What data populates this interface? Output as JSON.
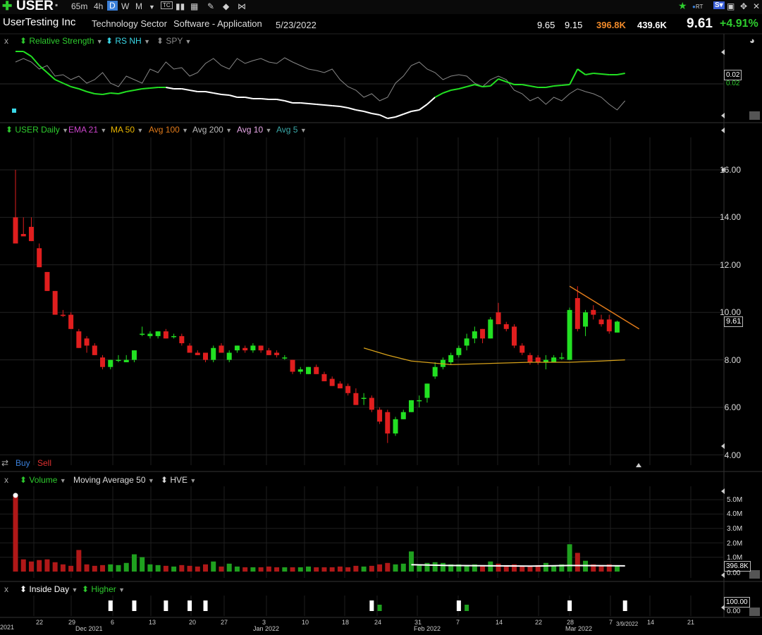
{
  "toolbar": {
    "symbol": "USER",
    "timeframes": [
      "65m",
      "4h",
      "D",
      "W",
      "M"
    ],
    "active_timeframe": "D",
    "rt_label": "RT"
  },
  "info": {
    "company": "UserTesting Inc",
    "sector": "Technology Sector",
    "industry": "Software - Application",
    "date": "5/23/2022",
    "high": "9.65",
    "low": "9.15",
    "volume": "396.8K",
    "avg_volume": "439.6K",
    "price": "9.61",
    "change": "+4.91%"
  },
  "rs_panel": {
    "close": "x",
    "items": [
      "Relative Strength",
      "RS NH",
      "SPY"
    ],
    "value_box": "0.02",
    "value_text": "0.02"
  },
  "price_panel": {
    "items": [
      "USER Daily",
      "EMA 21",
      "MA 50",
      "Avg 100",
      "Avg 200",
      "Avg 10",
      "Avg 5"
    ],
    "colors": [
      "#2ecc2e",
      "#cc44cc",
      "#e8b400",
      "#e07a1a",
      "#bbbbbb",
      "#e8a8e8",
      "#3aa8a8"
    ],
    "y_ticks": [
      "16.00",
      "14.00",
      "12.00",
      "10.00",
      "8.00",
      "6.00",
      "4.00"
    ],
    "price_box": "9.61",
    "buy_label": "Buy",
    "sell_label": "Sell"
  },
  "volume_panel": {
    "close": "x",
    "items": [
      "Volume",
      "Moving Average 50",
      "HVE"
    ],
    "y_ticks": [
      "5.0M",
      "4.0M",
      "3.0M",
      "2.0M",
      "1.0M",
      "0.00"
    ],
    "value_box": "396.8K"
  },
  "inside_panel": {
    "close": "x",
    "items": [
      "Inside Day",
      "Higher"
    ],
    "box_top": "100.00",
    "box_bottom": "0.00"
  },
  "dates": [
    "2021",
    "22",
    "29",
    "Dec 2021",
    "6",
    "13",
    "20",
    "27",
    "3",
    "Jan 2022",
    "10",
    "18",
    "24",
    "31",
    "Feb 2022",
    "7",
    "14",
    "22",
    "28",
    "Mar 2022",
    "7",
    "3/9/2022",
    "14",
    "21"
  ],
  "chart_data": {
    "type": "candlestick",
    "title": "USER Daily",
    "ylim": [
      3.5,
      17.5
    ],
    "candles": [
      {
        "o": 14.0,
        "h": 16.0,
        "l": 13.3,
        "c": 12.9,
        "v": 5.3
      },
      {
        "o": 13.3,
        "h": 14.0,
        "l": 13.3,
        "c": 13.2,
        "v": 0.85
      },
      {
        "o": 13.6,
        "h": 14.0,
        "l": 13.0,
        "c": 13.0,
        "v": 0.7
      },
      {
        "o": 12.7,
        "h": 12.9,
        "l": 11.9,
        "c": 11.9,
        "v": 0.8
      },
      {
        "o": 11.7,
        "h": 11.7,
        "l": 10.9,
        "c": 10.9,
        "v": 0.85
      },
      {
        "o": 10.9,
        "h": 10.9,
        "l": 9.9,
        "c": 9.9,
        "v": 0.65
      },
      {
        "o": 9.9,
        "h": 10.1,
        "l": 9.8,
        "c": 9.85,
        "v": 0.5
      },
      {
        "o": 9.9,
        "h": 10.0,
        "l": 9.3,
        "c": 9.3,
        "v": 0.4
      },
      {
        "o": 9.2,
        "h": 9.3,
        "l": 8.5,
        "c": 8.5,
        "v": 1.5
      },
      {
        "o": 8.9,
        "h": 9.0,
        "l": 8.3,
        "c": 8.6,
        "v": 0.5
      },
      {
        "o": 8.6,
        "h": 8.7,
        "l": 8.2,
        "c": 8.2,
        "v": 0.4
      },
      {
        "o": 8.1,
        "h": 8.2,
        "l": 7.6,
        "c": 7.7,
        "v": 0.45
      },
      {
        "o": 7.7,
        "h": 8.0,
        "l": 7.6,
        "c": 8.0,
        "v": 0.5
      },
      {
        "o": 8.0,
        "h": 8.2,
        "l": 7.9,
        "c": 8.0,
        "v": 0.45
      },
      {
        "o": 7.9,
        "h": 8.2,
        "l": 7.9,
        "c": 8.0,
        "v": 0.6
      },
      {
        "o": 8.0,
        "h": 8.4,
        "l": 7.9,
        "c": 8.4,
        "v": 1.2
      },
      {
        "o": 9.1,
        "h": 9.4,
        "l": 9.0,
        "c": 9.1,
        "v": 1.0
      },
      {
        "o": 9.0,
        "h": 9.2,
        "l": 8.9,
        "c": 9.1,
        "v": 0.5
      },
      {
        "o": 9.0,
        "h": 9.2,
        "l": 8.9,
        "c": 9.2,
        "v": 0.45
      },
      {
        "o": 9.2,
        "h": 9.3,
        "l": 8.9,
        "c": 8.9,
        "v": 0.4
      },
      {
        "o": 9.0,
        "h": 9.1,
        "l": 8.9,
        "c": 9.0,
        "v": 0.35
      },
      {
        "o": 9.0,
        "h": 9.1,
        "l": 8.6,
        "c": 8.7,
        "v": 0.45
      },
      {
        "o": 8.6,
        "h": 8.7,
        "l": 8.3,
        "c": 8.3,
        "v": 0.4
      },
      {
        "o": 8.3,
        "h": 8.4,
        "l": 8.2,
        "c": 8.2,
        "v": 0.35
      },
      {
        "o": 8.3,
        "h": 8.3,
        "l": 7.9,
        "c": 8.0,
        "v": 0.5
      },
      {
        "o": 8.0,
        "h": 8.6,
        "l": 7.9,
        "c": 8.5,
        "v": 0.7
      },
      {
        "o": 8.6,
        "h": 8.7,
        "l": 8.3,
        "c": 8.3,
        "v": 0.35
      },
      {
        "o": 8.0,
        "h": 8.4,
        "l": 7.9,
        "c": 8.3,
        "v": 0.55
      },
      {
        "o": 8.4,
        "h": 8.6,
        "l": 8.3,
        "c": 8.6,
        "v": 0.35
      },
      {
        "o": 8.5,
        "h": 8.6,
        "l": 8.3,
        "c": 8.4,
        "v": 0.3
      },
      {
        "o": 8.4,
        "h": 8.7,
        "l": 8.3,
        "c": 8.6,
        "v": 0.3
      },
      {
        "o": 8.6,
        "h": 8.6,
        "l": 8.3,
        "c": 8.4,
        "v": 0.3
      },
      {
        "o": 8.4,
        "h": 8.5,
        "l": 8.2,
        "c": 8.2,
        "v": 0.35
      },
      {
        "o": 8.3,
        "h": 8.4,
        "l": 8.1,
        "c": 8.2,
        "v": 0.3
      },
      {
        "o": 8.1,
        "h": 8.2,
        "l": 8.0,
        "c": 8.1,
        "v": 0.3
      },
      {
        "o": 8.0,
        "h": 8.0,
        "l": 7.4,
        "c": 7.5,
        "v": 0.3
      },
      {
        "o": 7.5,
        "h": 7.7,
        "l": 7.4,
        "c": 7.6,
        "v": 0.3
      },
      {
        "o": 7.4,
        "h": 7.7,
        "l": 7.4,
        "c": 7.7,
        "v": 0.35
      },
      {
        "o": 7.7,
        "h": 7.8,
        "l": 7.4,
        "c": 7.4,
        "v": 0.3
      },
      {
        "o": 7.4,
        "h": 7.5,
        "l": 7.1,
        "c": 7.1,
        "v": 0.3
      },
      {
        "o": 7.2,
        "h": 7.3,
        "l": 6.9,
        "c": 6.9,
        "v": 0.3
      },
      {
        "o": 7.0,
        "h": 7.1,
        "l": 6.8,
        "c": 6.8,
        "v": 0.35
      },
      {
        "o": 6.9,
        "h": 7.0,
        "l": 6.5,
        "c": 6.6,
        "v": 0.3
      },
      {
        "o": 6.6,
        "h": 6.8,
        "l": 6.1,
        "c": 6.1,
        "v": 0.4
      },
      {
        "o": 6.4,
        "h": 6.6,
        "l": 6.1,
        "c": 6.4,
        "v": 0.35
      },
      {
        "o": 6.4,
        "h": 6.5,
        "l": 5.8,
        "c": 5.9,
        "v": 0.4
      },
      {
        "o": 5.9,
        "h": 6.0,
        "l": 5.3,
        "c": 5.4,
        "v": 0.5
      },
      {
        "o": 5.8,
        "h": 5.9,
        "l": 4.5,
        "c": 4.9,
        "v": 0.6
      },
      {
        "o": 4.9,
        "h": 5.6,
        "l": 4.8,
        "c": 5.5,
        "v": 0.5
      },
      {
        "o": 5.5,
        "h": 5.9,
        "l": 5.5,
        "c": 5.8,
        "v": 0.55
      },
      {
        "o": 5.8,
        "h": 6.3,
        "l": 5.8,
        "c": 6.3,
        "v": 1.4
      },
      {
        "o": 6.3,
        "h": 6.5,
        "l": 6.0,
        "c": 6.3,
        "v": 0.5
      },
      {
        "o": 6.4,
        "h": 7.0,
        "l": 6.2,
        "c": 7.0,
        "v": 0.6
      },
      {
        "o": 7.3,
        "h": 7.9,
        "l": 7.2,
        "c": 7.7,
        "v": 0.65
      },
      {
        "o": 7.7,
        "h": 8.1,
        "l": 7.6,
        "c": 8.0,
        "v": 0.6
      },
      {
        "o": 7.9,
        "h": 8.3,
        "l": 7.8,
        "c": 8.2,
        "v": 0.5
      },
      {
        "o": 8.2,
        "h": 8.6,
        "l": 8.1,
        "c": 8.5,
        "v": 0.5
      },
      {
        "o": 8.6,
        "h": 9.1,
        "l": 8.4,
        "c": 8.9,
        "v": 0.45
      },
      {
        "o": 8.9,
        "h": 9.4,
        "l": 8.7,
        "c": 9.2,
        "v": 0.5
      },
      {
        "o": 9.3,
        "h": 9.3,
        "l": 8.7,
        "c": 8.9,
        "v": 0.45
      },
      {
        "o": 8.9,
        "h": 9.8,
        "l": 8.9,
        "c": 9.7,
        "v": 0.7
      },
      {
        "o": 10.0,
        "h": 10.4,
        "l": 9.5,
        "c": 9.5,
        "v": 0.55
      },
      {
        "o": 9.5,
        "h": 9.6,
        "l": 9.2,
        "c": 9.3,
        "v": 0.45
      },
      {
        "o": 9.4,
        "h": 9.5,
        "l": 8.5,
        "c": 8.6,
        "v": 0.5
      },
      {
        "o": 8.6,
        "h": 8.7,
        "l": 8.2,
        "c": 8.3,
        "v": 0.4
      },
      {
        "o": 8.2,
        "h": 8.3,
        "l": 7.8,
        "c": 7.9,
        "v": 0.4
      },
      {
        "o": 8.1,
        "h": 8.2,
        "l": 7.8,
        "c": 7.9,
        "v": 0.45
      },
      {
        "o": 7.9,
        "h": 8.2,
        "l": 7.6,
        "c": 8.0,
        "v": 0.6
      },
      {
        "o": 7.9,
        "h": 8.2,
        "l": 7.9,
        "c": 8.1,
        "v": 0.4
      },
      {
        "o": 8.1,
        "h": 8.3,
        "l": 8.0,
        "c": 8.1,
        "v": 0.5
      },
      {
        "o": 8.0,
        "h": 10.2,
        "l": 8.0,
        "c": 10.1,
        "v": 1.9
      },
      {
        "o": 10.6,
        "h": 11.1,
        "l": 9.2,
        "c": 9.3,
        "v": 1.3
      },
      {
        "o": 9.4,
        "h": 10.1,
        "l": 9.0,
        "c": 10.0,
        "v": 0.75
      },
      {
        "o": 10.1,
        "h": 10.3,
        "l": 9.7,
        "c": 9.9,
        "v": 0.5
      },
      {
        "o": 9.7,
        "h": 9.9,
        "l": 9.4,
        "c": 9.5,
        "v": 0.45
      },
      {
        "o": 9.7,
        "h": 9.9,
        "l": 9.1,
        "c": 9.2,
        "v": 0.5
      },
      {
        "o": 9.15,
        "h": 9.65,
        "l": 9.15,
        "c": 9.61,
        "v": 0.4
      }
    ],
    "ma50": [
      [
        44,
        8.5
      ],
      [
        47,
        8.2
      ],
      [
        50,
        7.95
      ],
      [
        55,
        7.8
      ],
      [
        60,
        7.85
      ],
      [
        65,
        7.9
      ],
      [
        70,
        7.9
      ],
      [
        74,
        7.95
      ],
      [
        77,
        8.0
      ]
    ],
    "trendline": [
      [
        70,
        11.1
      ],
      [
        77,
        9.3
      ]
    ],
    "rs_line": [
      0.95,
      0.95,
      0.88,
      0.75,
      0.65,
      0.55,
      0.5,
      0.45,
      0.42,
      0.38,
      0.35,
      0.34,
      0.36,
      0.35,
      0.38,
      0.4,
      0.42,
      0.43,
      0.44,
      0.44,
      0.42,
      0.42,
      0.4,
      0.38,
      0.38,
      0.36,
      0.34,
      0.33,
      0.3,
      0.3,
      0.28,
      0.28,
      0.27,
      0.27,
      0.25,
      0.22,
      0.22,
      0.21,
      0.2,
      0.19,
      0.18,
      0.17,
      0.15,
      0.12,
      0.1,
      0.07,
      0.05,
      0.0,
      0.02,
      0.06,
      0.1,
      0.12,
      0.2,
      0.3,
      0.36,
      0.4,
      0.42,
      0.45,
      0.48,
      0.45,
      0.46,
      0.56,
      0.52,
      0.48,
      0.48,
      0.46,
      0.44,
      0.44,
      0.46,
      0.47,
      0.48,
      0.7,
      0.62,
      0.64,
      0.63,
      0.62,
      0.62,
      0.64
    ],
    "spy_line": [
      0.8,
      0.85,
      0.8,
      0.7,
      0.75,
      0.6,
      0.62,
      0.55,
      0.6,
      0.5,
      0.55,
      0.65,
      0.5,
      0.45,
      0.6,
      0.55,
      0.5,
      0.7,
      0.65,
      0.8,
      0.7,
      0.72,
      0.6,
      0.65,
      0.78,
      0.85,
      0.75,
      0.7,
      0.85,
      0.78,
      0.82,
      0.85,
      0.8,
      0.78,
      0.86,
      0.8,
      0.75,
      0.7,
      0.68,
      0.65,
      0.7,
      0.55,
      0.45,
      0.4,
      0.3,
      0.35,
      0.25,
      0.3,
      0.5,
      0.6,
      0.75,
      0.8,
      0.7,
      0.65,
      0.55,
      0.6,
      0.62,
      0.6,
      0.5,
      0.45,
      0.55,
      0.6,
      0.55,
      0.4,
      0.35,
      0.25,
      0.3,
      0.2,
      0.3,
      0.25,
      0.35,
      0.42,
      0.38,
      0.35,
      0.3,
      0.2,
      0.12,
      0.25
    ],
    "vol_ma": 0.4,
    "inside_day_bars": [
      12,
      15,
      19,
      22,
      24,
      45,
      56,
      70,
      77
    ],
    "higher_bars": [
      46,
      57
    ]
  }
}
